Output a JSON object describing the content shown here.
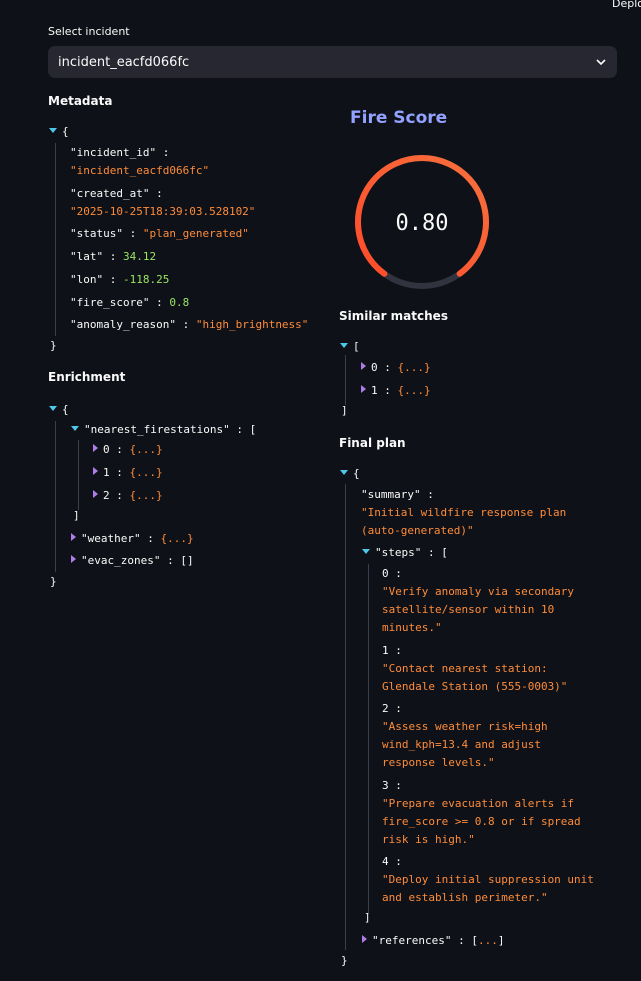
{
  "header": {
    "deploy_label": "Deploy"
  },
  "incident_select": {
    "label": "Select incident",
    "value": "incident_eacfd066fc"
  },
  "metadata": {
    "title": "Metadata",
    "incident_id_key": "\"incident_id\"",
    "incident_id_value": "\"incident_eacfd066fc\"",
    "created_at_key": "\"created_at\"",
    "created_at_value": "\"2025-10-25T18:39:03.528102\"",
    "status_key": "\"status\"",
    "status_value": "\"plan_generated\"",
    "lat_key": "\"lat\"",
    "lat_value": "34.12",
    "lon_key": "\"lon\"",
    "lon_value": "-118.25",
    "fire_score_key": "\"fire_score\"",
    "fire_score_value": "0.8",
    "anomaly_key": "\"anomaly_reason\"",
    "anomaly_value": "\"high_brightness\""
  },
  "enrichment": {
    "title": "Enrichment",
    "firestations_key": "\"nearest_firestations\"",
    "weather_key": "\"weather\"",
    "evac_key": "\"evac_zones\"",
    "evac_value": "[]"
  },
  "fire_score": {
    "title": "Fire Score",
    "value": 0.8,
    "display": "0.80",
    "track_color": "#31333f",
    "gradient_start": "#ff4b2b",
    "gradient_end": "#f6703c"
  },
  "similar": {
    "title": "Similar matches"
  },
  "plan": {
    "title": "Final plan",
    "summary_key": "\"summary\"",
    "summary_lines": [
      "\"Initial wildfire response plan",
      "(auto-generated)\""
    ],
    "steps_key": "\"steps\"",
    "steps": [
      [
        "\"Verify anomaly via secondary",
        "satellite/sensor within 10",
        "minutes.\""
      ],
      [
        "\"Contact nearest station:",
        "Glendale Station (555-0003)\""
      ],
      [
        "\"Assess weather risk=high",
        "wind_kph=13.4 and adjust",
        "response levels.\""
      ],
      [
        "\"Prepare evacuation alerts if",
        "fire_score >= 0.8 or if spread",
        "risk is high.\""
      ],
      [
        "\"Deploy initial suppression unit",
        "and establish perimeter.\""
      ]
    ],
    "references_key": "\"references\""
  },
  "syntax": {
    "open_brace": "{",
    "close_brace": "}",
    "open_bracket": "[",
    "close_bracket": "]",
    "collapsed_obj": "{...}",
    "collapsed_arr": "[...]",
    "colon": ":"
  }
}
